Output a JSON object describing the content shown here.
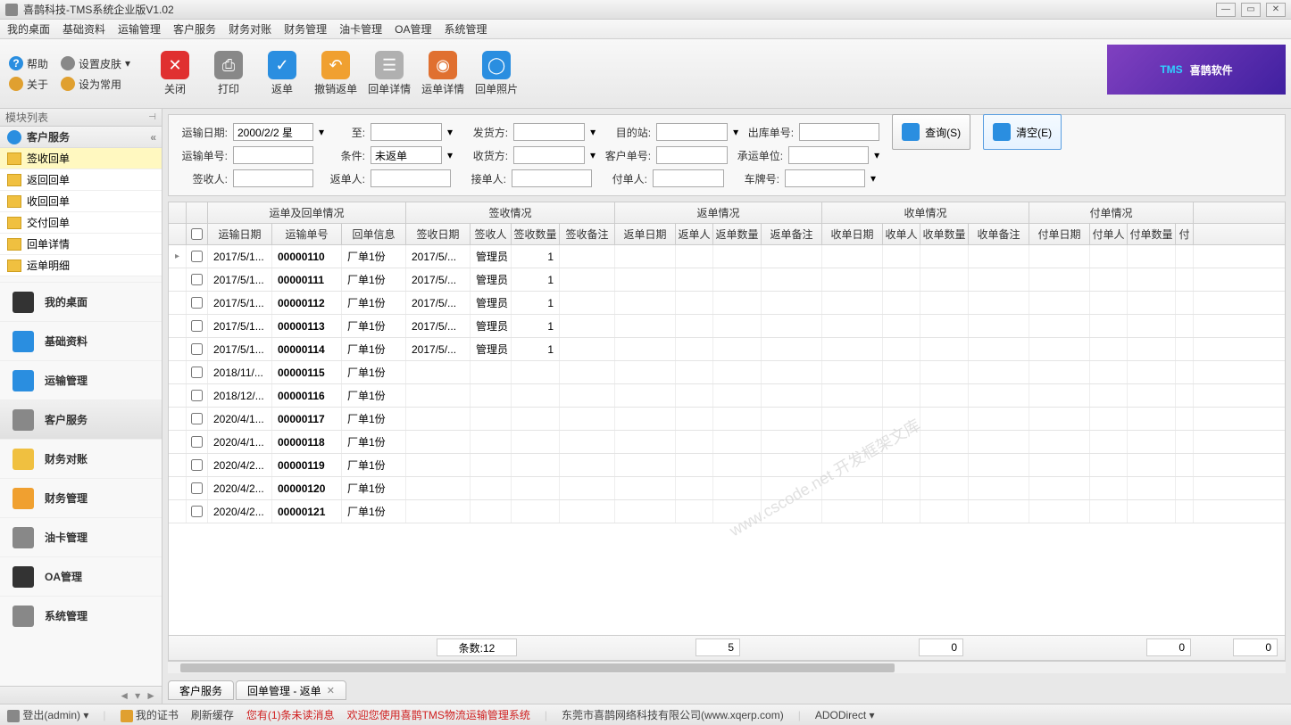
{
  "window": {
    "title": "喜鹊科技-TMS系统企业版V1.02"
  },
  "menubar": [
    "我的桌面",
    "基础资料",
    "运输管理",
    "客户服务",
    "财务对账",
    "财务管理",
    "油卡管理",
    "OA管理",
    "系统管理"
  ],
  "toolbar_links": {
    "help": "帮助",
    "skin": "设置皮肤",
    "about": "关于",
    "fav": "设为常用"
  },
  "toolbar_buttons": {
    "close": "关闭",
    "print": "打印",
    "return": "返单",
    "undo": "撤销返单",
    "detail": "回单详情",
    "tdetail": "运单详情",
    "photo": "回单照片"
  },
  "logo": {
    "tms": "TMS",
    "text": "喜鹊软件"
  },
  "sidebar": {
    "list_title": "模块列表",
    "top": "客户服务",
    "items": [
      "签收回单",
      "返回回单",
      "收回回单",
      "交付回单",
      "回单详情",
      "运单明细"
    ],
    "selected_index": 0,
    "modules": [
      "我的桌面",
      "基础资料",
      "运输管理",
      "客户服务",
      "财务对账",
      "财务管理",
      "油卡管理",
      "OA管理",
      "系统管理"
    ],
    "active_module_index": 3
  },
  "filter": {
    "labels": {
      "trans_date": "运输日期:",
      "to": "至:",
      "shipper": "发货方:",
      "dest": "目的站:",
      "out_no": "出库单号:",
      "trans_no": "运输单号:",
      "cond": "条件:",
      "receiver": "收货方:",
      "cust_no": "客户单号:",
      "carrier": "承运单位:",
      "sign_by": "签收人:",
      "return_by": "返单人:",
      "accept_by": "接单人:",
      "pay_by": "付单人:",
      "plate": "车牌号:"
    },
    "values": {
      "trans_date": "2000/2/2 星",
      "cond": "未返单"
    },
    "buttons": {
      "query": "查询(S)",
      "clear": "清空(E)"
    }
  },
  "grid": {
    "groups": [
      "运单及回单情况",
      "签收情况",
      "返单情况",
      "收单情况",
      "付单情况"
    ],
    "cols": {
      "trans_date": "运输日期",
      "trans_no": "运输单号",
      "info": "回单信息",
      "sdate": "签收日期",
      "sby": "签收人",
      "sqty": "签收数量",
      "snote": "签收备注",
      "rdate": "返单日期",
      "rby": "返单人",
      "rqty": "返单数量",
      "rnote": "返单备注",
      "cdate": "收单日期",
      "cby": "收单人",
      "cqty": "收单数量",
      "cnote": "收单备注",
      "pdate": "付单日期",
      "pby": "付单人",
      "pqty": "付单数量",
      "px": "付"
    },
    "rows": [
      {
        "date": "2017/5/1...",
        "no": "00000110",
        "info": "厂单1份",
        "sdate": "2017/5/...",
        "sby": "管理员",
        "sqty": 1
      },
      {
        "date": "2017/5/1...",
        "no": "00000111",
        "info": "厂单1份",
        "sdate": "2017/5/...",
        "sby": "管理员",
        "sqty": 1
      },
      {
        "date": "2017/5/1...",
        "no": "00000112",
        "info": "厂单1份",
        "sdate": "2017/5/...",
        "sby": "管理员",
        "sqty": 1
      },
      {
        "date": "2017/5/1...",
        "no": "00000113",
        "info": "厂单1份",
        "sdate": "2017/5/...",
        "sby": "管理员",
        "sqty": 1
      },
      {
        "date": "2017/5/1...",
        "no": "00000114",
        "info": "厂单1份",
        "sdate": "2017/5/...",
        "sby": "管理员",
        "sqty": 1
      },
      {
        "date": "2018/11/...",
        "no": "00000115",
        "info": "厂单1份"
      },
      {
        "date": "2018/12/...",
        "no": "00000116",
        "info": "厂单1份"
      },
      {
        "date": "2020/4/1...",
        "no": "00000117",
        "info": "厂单1份"
      },
      {
        "date": "2020/4/1...",
        "no": "00000118",
        "info": "厂单1份"
      },
      {
        "date": "2020/4/2...",
        "no": "00000119",
        "info": "厂单1份"
      },
      {
        "date": "2020/4/2...",
        "no": "00000120",
        "info": "厂单1份"
      },
      {
        "date": "2020/4/2...",
        "no": "00000121",
        "info": "厂单1份"
      }
    ],
    "footer": {
      "count": "条数:12",
      "sqty": "5",
      "rqty": "0",
      "cqty": "0",
      "pqty": "0"
    }
  },
  "bottom_tabs": [
    "客户服务",
    "回单管理 - 返单"
  ],
  "status": {
    "login": "登出(admin)",
    "cert": "我的证书",
    "refresh": "刷新缓存",
    "unread": "您有(1)条未读消息",
    "welcome": "欢迎您使用喜鹊TMS物流运输管理系统",
    "company": "东莞市喜鹊网络科技有限公司(www.xqerp.com)",
    "ado": "ADODirect"
  },
  "watermark": "www.cscode.net 开发框架文库"
}
